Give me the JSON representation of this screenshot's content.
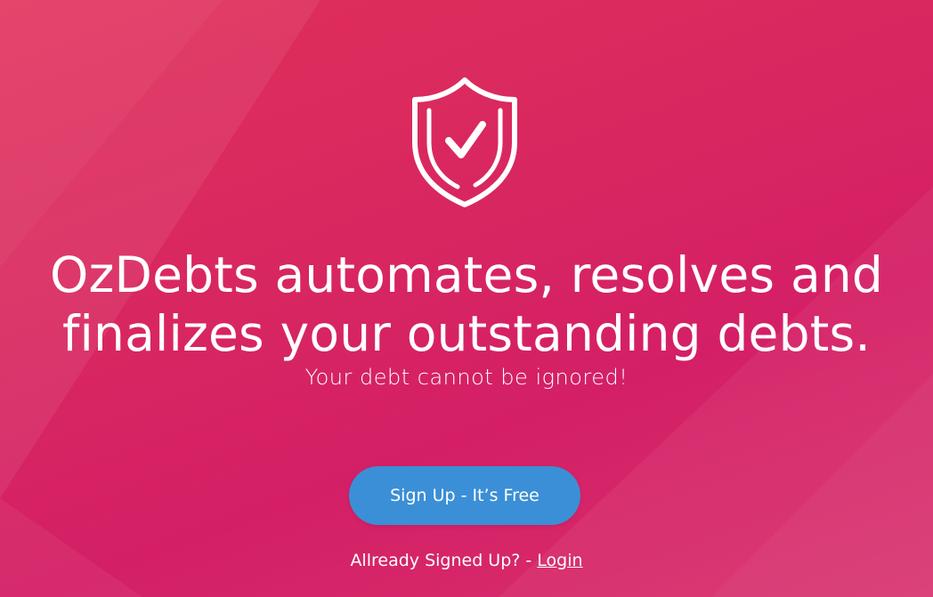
{
  "hero": {
    "icon": "shield-check-icon",
    "headline_line1": "OzDebts automates, resolves and",
    "headline_line2": "finalizes your outstanding debts.",
    "subline": "Your debt cannot be ignored!",
    "cta_label": "Sign Up - It’s Free",
    "login_prompt": "Allready Signed Up? - ",
    "login_link": "Login"
  },
  "colors": {
    "background": "#d9285f",
    "button": "#3b8fd6",
    "text": "#ffffff"
  }
}
